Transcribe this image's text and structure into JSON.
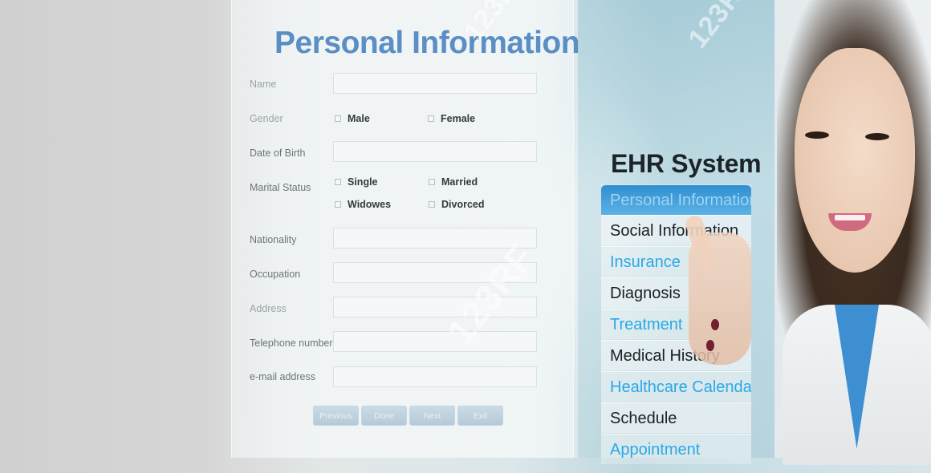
{
  "form": {
    "title": "Personal Information",
    "labels": {
      "name": "Name",
      "gender": "Gender",
      "dob": "Date of Birth",
      "marital": "Marital Status",
      "nationality": "Nationality",
      "occupation": "Occupation",
      "address": "Address",
      "telephone": "Telephone number",
      "email": "e-mail address"
    },
    "gender_options": [
      "Male",
      "Female"
    ],
    "marital_options": [
      "Single",
      "Married",
      "Widowes",
      "Divorced"
    ],
    "buttons": [
      "Previous",
      "Done",
      "Next",
      "Exit"
    ]
  },
  "ehr": {
    "title": "EHR System",
    "menu": [
      "Personal Information",
      "Social Information",
      "Insurance",
      "Diagnosis",
      "Treatment",
      "Medical History",
      "Healthcare Calendar",
      "Schedule",
      "Appointment"
    ]
  },
  "watermark": "123RF",
  "colors": {
    "title_blue": "#5a8ec4",
    "menu_active": "#2f8fcf",
    "menu_blue_text": "#2aa8e6",
    "menu_dark_text": "#1a2024"
  }
}
